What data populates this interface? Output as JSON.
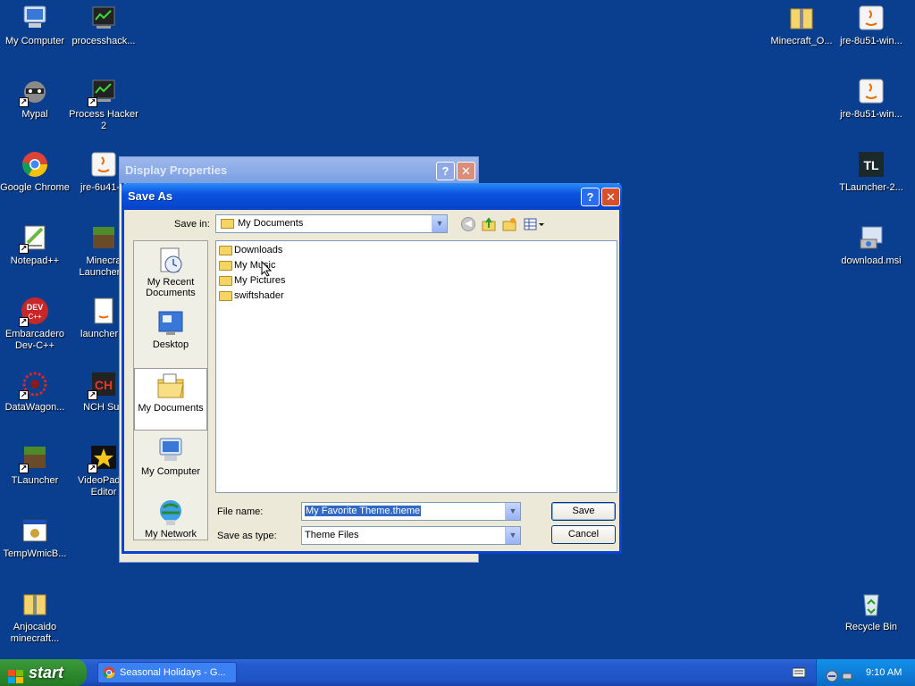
{
  "desktop_icons": [
    {
      "name": "my-computer",
      "label": "My Computer"
    },
    {
      "name": "processhacker",
      "label": "processhack..."
    },
    {
      "name": "mypal",
      "label": "Mypal"
    },
    {
      "name": "process-hacker-2",
      "label": "Process Hacker 2"
    },
    {
      "name": "google-chrome",
      "label": "Google Chrome"
    },
    {
      "name": "jre-6u41",
      "label": "jre-6u41-w"
    },
    {
      "name": "notepad-pp",
      "label": "Notepad++"
    },
    {
      "name": "minecraft-launcher",
      "label": "Minecra Launcher b"
    },
    {
      "name": "embarcadero-devcpp",
      "label": "Embarcadero Dev-C++"
    },
    {
      "name": "launcher-1",
      "label": "launcher-1"
    },
    {
      "name": "datawagon",
      "label": "DataWagon..."
    },
    {
      "name": "nch-suite",
      "label": "NCH Suit"
    },
    {
      "name": "tlauncher",
      "label": "TLauncher"
    },
    {
      "name": "videopad",
      "label": "VideoPad V Editor"
    },
    {
      "name": "tempwmicb",
      "label": "TempWmicB..."
    },
    {
      "name": "anjocaido",
      "label": "Anjocaido minecraft..."
    },
    {
      "name": "minecraft-o",
      "label": "Minecraft_O..."
    },
    {
      "name": "jre-8u51-a",
      "label": "jre-8u51-win..."
    },
    {
      "name": "jre-8u51-b",
      "label": "jre-8u51-win..."
    },
    {
      "name": "tlauncher-2",
      "label": "TLauncher-2..."
    },
    {
      "name": "download-msi",
      "label": "download.msi"
    },
    {
      "name": "recycle-bin",
      "label": "Recycle Bin"
    }
  ],
  "background_dialog": {
    "title": "Display Properties",
    "help": "?",
    "close": "✕"
  },
  "save_dialog": {
    "title": "Save As",
    "help": "?",
    "close": "✕",
    "save_in_label": "Save in:",
    "save_in_value": "My Documents",
    "places": [
      {
        "label": "My Recent Documents"
      },
      {
        "label": "Desktop"
      },
      {
        "label": "My Documents"
      },
      {
        "label": "My Computer"
      },
      {
        "label": "My Network"
      }
    ],
    "files": [
      "Downloads",
      "My Music",
      "My Pictures",
      "swiftshader"
    ],
    "file_name_label": "File name:",
    "file_name_value": "My Favorite Theme.theme",
    "save_as_type_label": "Save as type:",
    "save_as_type_value": "Theme Files",
    "save_button": "Save",
    "cancel_button": "Cancel"
  },
  "taskbar": {
    "start_label": "start",
    "task_label": "Seasonal Holidays - G...",
    "clock": "9:10 AM"
  },
  "colors": {
    "desktop": "#0a3e8e",
    "titlebar": "#0842d2",
    "start_green": "#2f8a2f",
    "dialog_face": "#ece9d8"
  }
}
